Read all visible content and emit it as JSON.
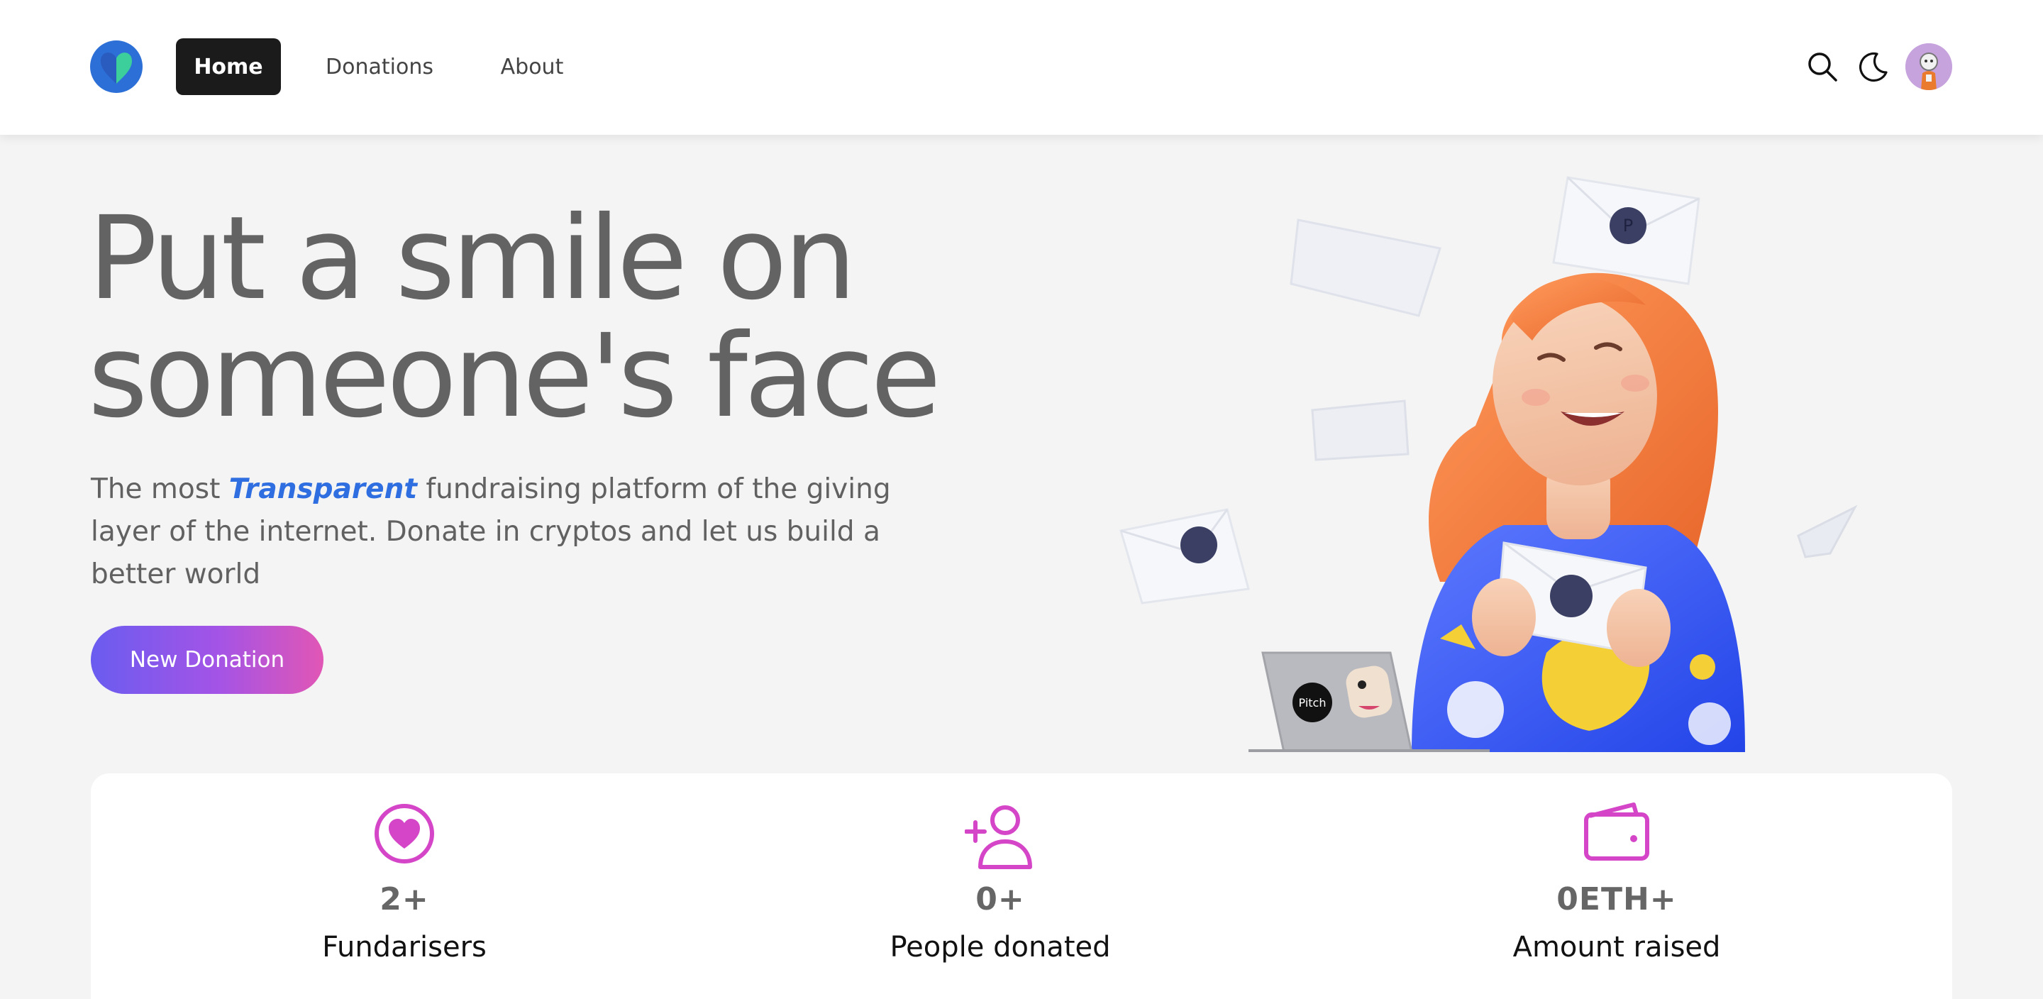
{
  "nav": {
    "links": [
      {
        "label": "Home",
        "active": true
      },
      {
        "label": "Donations",
        "active": false
      },
      {
        "label": "About",
        "active": false
      }
    ],
    "icons": [
      "search-icon",
      "moon-icon",
      "avatar"
    ]
  },
  "hero": {
    "title_line1": "Put a smile on",
    "title_line2": "someone's face",
    "subtitle_pre": "The most ",
    "subtitle_highlight": "Transparent",
    "subtitle_post": " fundraising platform of the giving layer of the internet. Donate in cryptos and let us build a better world",
    "cta_label": "New Donation"
  },
  "illustration": {
    "laptop_sticker_text": "Pitch"
  },
  "stats": [
    {
      "icon": "heart-circle-icon",
      "value": "2+",
      "label": "Fundarisers"
    },
    {
      "icon": "user-plus-icon",
      "value": "0+",
      "label": "People donated"
    },
    {
      "icon": "wallet-icon",
      "value": "0ETH+",
      "label": "Amount raised"
    }
  ],
  "colors": {
    "accent_blue": "#2f6ee0",
    "stat_icon": "#d545c8",
    "cta_gradient_start": "#6a5cf0",
    "cta_gradient_end": "#e156b5",
    "nav_active_bg": "#1b1b1b"
  }
}
